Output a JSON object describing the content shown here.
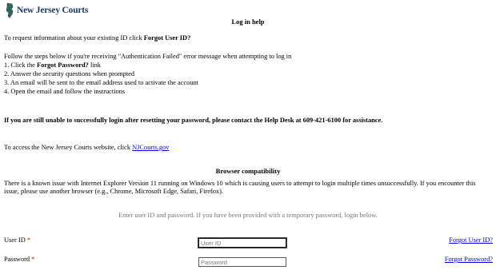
{
  "header": {
    "logo_text": "New Jersey Courts"
  },
  "help": {
    "title": "Log in help",
    "forgot_id_intro": "To request information about your existing ID click ",
    "forgot_id_bold": "Forgot User ID?",
    "auth_failed_intro": "Follow the steps below if you're receiving \"Authentication Failed\" error message when attempting to log in",
    "step1_prefix": "1. Click the ",
    "step1_bold": "Forgot Password?",
    "step1_suffix": " link",
    "step2": "2. Answer the security questions when prompted",
    "step3": "3. An email will be sent to the email address used to activate the account",
    "step4": "4. Open the email and follow the instructions",
    "helpdesk_note": "If you are still unable to successfully login after resetting your password, please contact the Help Desk at 609-421-6100 for assistance.",
    "website_prefix": "To access the New Jersey Courts website, click ",
    "website_link": "NJCourts.gov"
  },
  "compat": {
    "title": "Browser compatibility",
    "text": "There is a known issue with Internet Explorer Version 11 running on Windows 10 which is causing users to attempt to login multiple times unsuccessfully. If you encounter this issue, please use another browser (e.g., Chrome, Microsoft Edge, Safari, Firefox)."
  },
  "login": {
    "instruction": "Enter user ID and password. If you have been provided with a temporary password, login below.",
    "userid_label": "User ID",
    "userid_placeholder": "User ID",
    "password_label": "Password",
    "password_placeholder": "Password",
    "required_mark": "*",
    "forgot_userid": "Forgot User ID?",
    "forgot_password": "Forgot Password?"
  }
}
